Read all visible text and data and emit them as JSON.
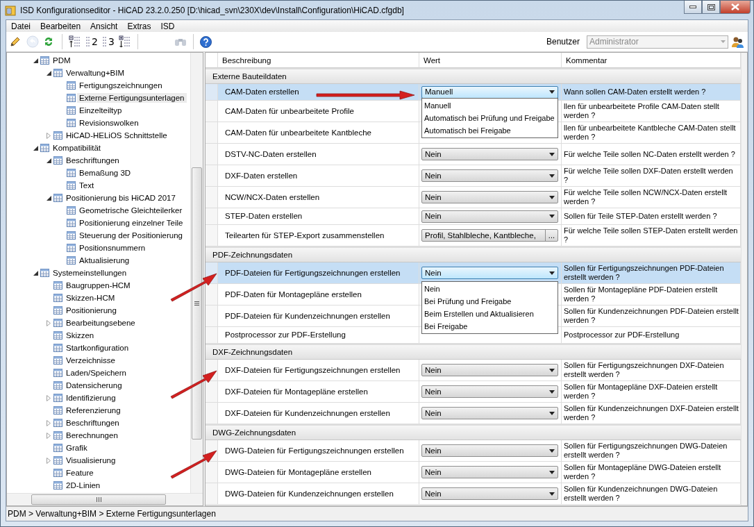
{
  "window": {
    "title": "ISD Konfigurationseditor  - HiCAD 23.2.0.250 [D:\\hicad_svn\\230X\\dev\\Install\\Configuration\\HiCAD.cfgdb]"
  },
  "menu": [
    "Datei",
    "Bearbeiten",
    "Ansicht",
    "Extras",
    "ISD"
  ],
  "toolbar": {
    "tools": [
      {
        "kind": "pencil",
        "disabled": false
      },
      {
        "kind": "undo",
        "disabled": true
      },
      {
        "kind": "refresh",
        "disabled": false
      },
      {
        "kind": "level-up",
        "disabled": false
      },
      {
        "kind": "level",
        "label": "2",
        "disabled": false
      },
      {
        "kind": "level",
        "label": "3",
        "disabled": false
      },
      {
        "kind": "level-down",
        "disabled": false
      }
    ],
    "user_label": "Benutzer",
    "user": {
      "value": "Administrator",
      "disabled": true
    }
  },
  "tree": [
    {
      "label": "PDM",
      "expanded": true,
      "selected": false,
      "children": [
        {
          "label": "Verwaltung+BIM",
          "expanded": true,
          "selected": false,
          "children": [
            {
              "label": "Fertigungszeichnungen",
              "selected": false
            },
            {
              "label": "Externe Fertigungsunterlagen",
              "selected": true
            },
            {
              "label": "Einzelteiltyp",
              "selected": false
            },
            {
              "label": "Revisionswolken",
              "selected": false
            }
          ]
        },
        {
          "label": "HiCAD-HELiOS Schnittstelle",
          "expanded": false,
          "selected": false
        }
      ]
    },
    {
      "label": "Kompatibilität",
      "expanded": true,
      "selected": false,
      "children": [
        {
          "label": "Beschriftungen",
          "expanded": true,
          "selected": false,
          "children": [
            {
              "label": "Bemaßung 3D",
              "selected": false
            },
            {
              "label": "Text",
              "selected": false
            }
          ]
        },
        {
          "label": "Positionierung bis HiCAD 2017",
          "expanded": true,
          "selected": false,
          "children": [
            {
              "label": "Geometrische Gleichteilerker",
              "selected": false
            },
            {
              "label": "Positionierung einzelner Teile",
              "selected": false
            },
            {
              "label": "Steuerung der Positionierung",
              "selected": false
            },
            {
              "label": "Positionsnummern",
              "selected": false
            },
            {
              "label": "Aktualisierung",
              "selected": false
            }
          ]
        }
      ]
    },
    {
      "label": "Systemeinstellungen",
      "expanded": true,
      "selected": false,
      "children": [
        {
          "label": "Baugruppen-HCM",
          "selected": false
        },
        {
          "label": "Skizzen-HCM",
          "selected": false
        },
        {
          "label": "Positionierung",
          "selected": false
        },
        {
          "label": "Bearbeitungsebene",
          "expanded": false,
          "selected": false
        },
        {
          "label": "Skizzen",
          "selected": false
        },
        {
          "label": "Startkonfiguration",
          "selected": false
        },
        {
          "label": "Verzeichnisse",
          "selected": false
        },
        {
          "label": "Laden/Speichern",
          "selected": false
        },
        {
          "label": "Datensicherung",
          "selected": false
        },
        {
          "label": "Identifizierung",
          "expanded": false,
          "selected": false
        },
        {
          "label": "Referenzierung",
          "selected": false
        },
        {
          "label": "Beschriftungen",
          "expanded": false,
          "selected": false
        },
        {
          "label": "Berechnungen",
          "expanded": false,
          "selected": false
        },
        {
          "label": "Grafik",
          "selected": false
        },
        {
          "label": "Visualisierung",
          "expanded": false,
          "selected": false
        },
        {
          "label": "Feature",
          "selected": false
        },
        {
          "label": "2D-Linien",
          "selected": false
        }
      ]
    }
  ],
  "table": {
    "columns": [
      "Beschreibung",
      "Wert",
      "Kommentar"
    ],
    "rows": [
      {
        "kind": "group",
        "label": "Externe Bauteildaten"
      },
      {
        "kind": "setting",
        "description": "CAM-Daten erstellen",
        "value": {
          "kind": "select",
          "text": "Manuell",
          "options": [
            "Manuell",
            "Automatisch bei Prüfung und Freigabe",
            "Automatisch bei Freigabe"
          ]
        },
        "comment": "Wann sollen CAM-Daten erstellt werden ?",
        "selected": true
      },
      {
        "kind": "setting",
        "description": "CAM-Daten für unbearbeitete Profile",
        "value": {
          "kind": "covered"
        },
        "comment": "llen für unbearbeitete Profile CAM-Daten stellt werden ?",
        "selected": false
      },
      {
        "kind": "setting",
        "description": "CAM-Daten für unbearbeitete Kantbleche",
        "value": {
          "kind": "covered"
        },
        "comment": "llen für unbearbeitete Kantbleche CAM-Daten stellt werden ?",
        "selected": false
      },
      {
        "kind": "setting",
        "description": "DSTV-NC-Daten erstellen",
        "value": {
          "kind": "select",
          "text": "Nein"
        },
        "comment": "Für welche Teile sollen NC-Daten erstellt werden ?",
        "selected": false
      },
      {
        "kind": "setting",
        "description": "DXF-Daten erstellen",
        "value": {
          "kind": "select",
          "text": "Nein"
        },
        "comment": "Für welche Teile sollen DXF-Daten erstellt werden ?",
        "selected": false
      },
      {
        "kind": "setting",
        "description": "NCW/NCX-Daten erstellen",
        "value": {
          "kind": "select",
          "text": "Nein"
        },
        "comment": "Für welche Teile sollen NCW/NCX-Daten erstellt werden ?",
        "selected": false
      },
      {
        "kind": "setting",
        "description": "STEP-Daten erstellen",
        "value": {
          "kind": "select",
          "text": "Nein"
        },
        "comment": "Sollen für Teile STEP-Daten erstellt werden ?",
        "selected": false
      },
      {
        "kind": "setting",
        "description": "Teilearten für STEP-Export zusammenstellen",
        "value": {
          "kind": "picker",
          "text": "Profil, Stahlbleche, Kantbleche,",
          "button": "..."
        },
        "comment": "Für welche Teile sollen STEP-Daten erstellt werden ?",
        "selected": false
      },
      {
        "kind": "group",
        "label": "PDF-Zeichnungsdaten"
      },
      {
        "kind": "setting",
        "description": "PDF-Dateien für Fertigungszeichnungen erstellen",
        "value": {
          "kind": "select",
          "text": "Nein",
          "options": [
            "Nein",
            "Bei Prüfung und Freigabe",
            "Beim Erstellen und Aktualisieren",
            "Bei Freigabe"
          ]
        },
        "comment": "Sollen für Fertigungszeichnungen PDF-Dateien erstellt werden ?",
        "selected": true
      },
      {
        "kind": "setting",
        "description": "PDF-Daten für Montagepläne erstellen",
        "value": {
          "kind": "covered"
        },
        "comment": "Sollen für Montagepläne PDF-Dateien erstellt werden ?",
        "selected": false
      },
      {
        "kind": "setting",
        "description": "PDF-Dateien für Kundenzeichnungen erstellen",
        "value": {
          "kind": "covered"
        },
        "comment": "Sollen für Kundenzeichnungen PDF-Dateien erstellt werden ?",
        "selected": false
      },
      {
        "kind": "setting",
        "description": "Postprocessor zur PDF-Erstellung",
        "value": {
          "kind": "empty"
        },
        "comment": "Postprocessor zur PDF-Erstellung",
        "selected": false
      },
      {
        "kind": "group",
        "label": "DXF-Zeichnungsdaten"
      },
      {
        "kind": "setting",
        "description": "DXF-Dateien für Fertigungszeichnungen erstellen",
        "value": {
          "kind": "select",
          "text": "Nein"
        },
        "comment": "Sollen für Fertigungszeichnungen DXF-Dateien erstellt werden ?",
        "selected": false
      },
      {
        "kind": "setting",
        "description": "DXF-Dateien für Montagepläne erstellen",
        "value": {
          "kind": "select",
          "text": "Nein"
        },
        "comment": "Sollen für Montagepläne DXF-Dateien erstellt werden ?",
        "selected": false
      },
      {
        "kind": "setting",
        "description": "DXF-Dateien für Kundenzeichnungen erstellen",
        "value": {
          "kind": "select",
          "text": "Nein"
        },
        "comment": "Sollen für Kundenzeichnungen DXF-Dateien erstellt werden ?",
        "selected": false
      },
      {
        "kind": "group",
        "label": "DWG-Zeichnungsdaten"
      },
      {
        "kind": "setting",
        "description": "DWG-Dateien für Fertigungszeichnungen erstellen",
        "value": {
          "kind": "select",
          "text": "Nein"
        },
        "comment": "Sollen für Fertigungszeichnungen DWG-Dateien erstellt werden ?",
        "selected": false
      },
      {
        "kind": "setting",
        "description": "DWG-Dateien für Montagepläne erstellen",
        "value": {
          "kind": "select",
          "text": "Nein"
        },
        "comment": "Sollen für Montagepläne DWG-Dateien erstellt werden ?",
        "selected": false
      },
      {
        "kind": "setting",
        "description": "DWG-Dateien für Kundenzeichnungen erstellen",
        "value": {
          "kind": "select",
          "text": "Nein"
        },
        "comment": "Sollen für Kundenzeichnungen DWG-Dateien erstellt werden ?",
        "selected": false
      }
    ]
  },
  "status_bar": "PDM > Verwaltung+BIM > Externe Fertigungsunterlagen"
}
